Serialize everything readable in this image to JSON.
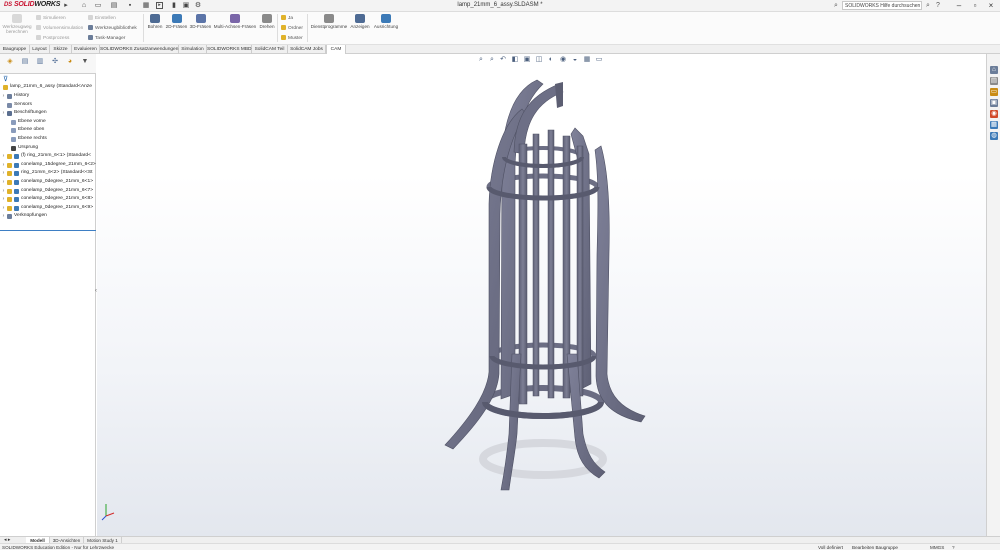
{
  "app": {
    "logo_prefix": "DS",
    "logo_main": "SOLID",
    "logo_suffix": "WORKS"
  },
  "window": {
    "document_title": "lamp_21mm_6_assy.SLDASM *",
    "help_search_placeholder": "SOLIDWORKS Hilfe durchsuchen"
  },
  "command_manager": {
    "group1": {
      "werkzeugweg": "Werkzeugweg berechnen",
      "simulieren": "Simulieren",
      "volumen": "Volumensimulation",
      "postprocess": "Postprozess",
      "einstellen": "Einstellen",
      "werkzeugbib": "Werkzeugbibliothek",
      "taskmanager": "Task-Manager"
    },
    "buttons": [
      "Bohren",
      "2D-Fräsen",
      "3D-Fräsen",
      "Multi-Achsen-Fräsen",
      "Drehen"
    ],
    "right_group": {
      "ja": "Ja",
      "ordner": "Ordner",
      "muster": "Muster",
      "dienst": "Dienstprogramme",
      "anzeigen": "Anzeigen",
      "ausrichtung": "Ausrichtung"
    }
  },
  "tabs": [
    "Baugruppe",
    "Layout",
    "Skizze",
    "Evaluieren",
    "SOLIDWORKS Zusatzanwendungen",
    "Simulation",
    "SOLIDWORKS MBD",
    "SolidCAM Teil",
    "SolidCAM Jobs",
    "CAM"
  ],
  "active_tab": "CAM",
  "feature_tree": {
    "root": "lamp_21mm_6_assy (Standard<Anze",
    "items": [
      {
        "label": "History",
        "icon": "history-icon",
        "color": "#6c7e9c"
      },
      {
        "label": "Sensors",
        "icon": "sensor-icon",
        "color": "#7a8aa8"
      },
      {
        "label": "Beschriftungen",
        "icon": "annotations-icon",
        "color": "#5b6f90"
      },
      {
        "label": "Ebene vorne",
        "icon": "plane-icon",
        "color": "#8a9cbc"
      },
      {
        "label": "Ebene oben",
        "icon": "plane-icon",
        "color": "#8a9cbc"
      },
      {
        "label": "Ebene rechts",
        "icon": "plane-icon",
        "color": "#8a9cbc"
      },
      {
        "label": "Ursprung",
        "icon": "origin-icon",
        "color": "#444444"
      },
      {
        "label": "(f) ring_21mm_6<1> (Standard<",
        "icon": "part-icon",
        "color": "#e0b22a"
      },
      {
        "label": "conelamp_15degree_21mm_6<2>",
        "icon": "part-icon",
        "color": "#e0b22a"
      },
      {
        "label": "ring_21mm_6<2> (Standard<<St",
        "icon": "part-icon",
        "color": "#e0b22a"
      },
      {
        "label": "conelamp_0degree_21mm_6<1>",
        "icon": "part-icon",
        "color": "#e0b22a"
      },
      {
        "label": "conelamp_0degree_21mm_6<7>",
        "icon": "part-icon",
        "color": "#e0b22a"
      },
      {
        "label": "conelamp_0degree_21mm_6<8>",
        "icon": "part-icon",
        "color": "#e0b22a"
      },
      {
        "label": "conelamp_0degree_21mm_6<9>",
        "icon": "part-icon",
        "color": "#e0b22a"
      },
      {
        "label": "Verknüpfungen",
        "icon": "mates-icon",
        "color": "#6c7e9c"
      }
    ]
  },
  "bottom_tabs": [
    "Modell",
    "3D-Ansichten",
    "Motion Study 1"
  ],
  "status": {
    "left": "SOLIDWORKS Education Edition - Nur für Lehrzwecke",
    "defined": "Voll definiert",
    "editing": "Bearbeiten Baugruppe",
    "units": "MMGS"
  },
  "colors": {
    "model": "#73758b",
    "accent": "#1c5fa8",
    "brand": "#c8102e"
  }
}
